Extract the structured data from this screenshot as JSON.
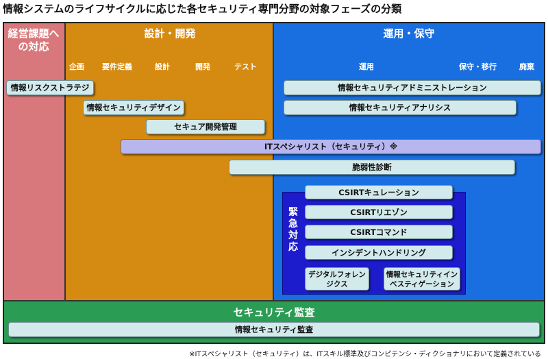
{
  "title": "情報システムのライフサイクルに応じた各セキュリティ専門分野の対象フェーズの分類",
  "columns": {
    "mgmt": "経営課題への対応",
    "dev": "設計・開発",
    "ops": "運用・保守"
  },
  "phases": {
    "planning": "企画",
    "requirements": "要件定義",
    "design": "設計",
    "development": "開発",
    "test": "テスト",
    "operation": "運用",
    "maintenance": "保守・移行",
    "disposal": "廃棄"
  },
  "bars": {
    "strategy": "情報リスクストラテジ",
    "security_design": "情報セキュリティデザイン",
    "secure_dev": "セキュア開発管理",
    "admin": "情報セキュリティアドミニストレーション",
    "analysis": "情報セキュリティアナリシス",
    "it_specialist": "ITスペシャリスト（セキュリティ）※",
    "vuln": "脆弱性診断"
  },
  "emergency": {
    "label": "緊急対応",
    "items": [
      "CSIRTキュレーション",
      "CSIRTリエゾン",
      "CSIRTコマンド",
      "インシデントハンドリング"
    ],
    "forensics": "デジタルフォレンジクス",
    "investigation": "情報セキュリティインベスティゲーション"
  },
  "audit": {
    "header": "セキュリティ監査",
    "bar": "情報セキュリティ監査"
  },
  "footnote": "※ITスペシャリスト（セキュリティ）は、ITスキル標準及びコンピテンシ・ディクショナリにおいて定義されている",
  "colors": {
    "mgmt": "#d9787c",
    "dev": "#d58a12",
    "ops": "#1a6fe0",
    "emergency": "#1d1ccc",
    "audit": "#2a9c53",
    "bar": "#d3eaec",
    "bar_purple": "#b8b6ee"
  }
}
